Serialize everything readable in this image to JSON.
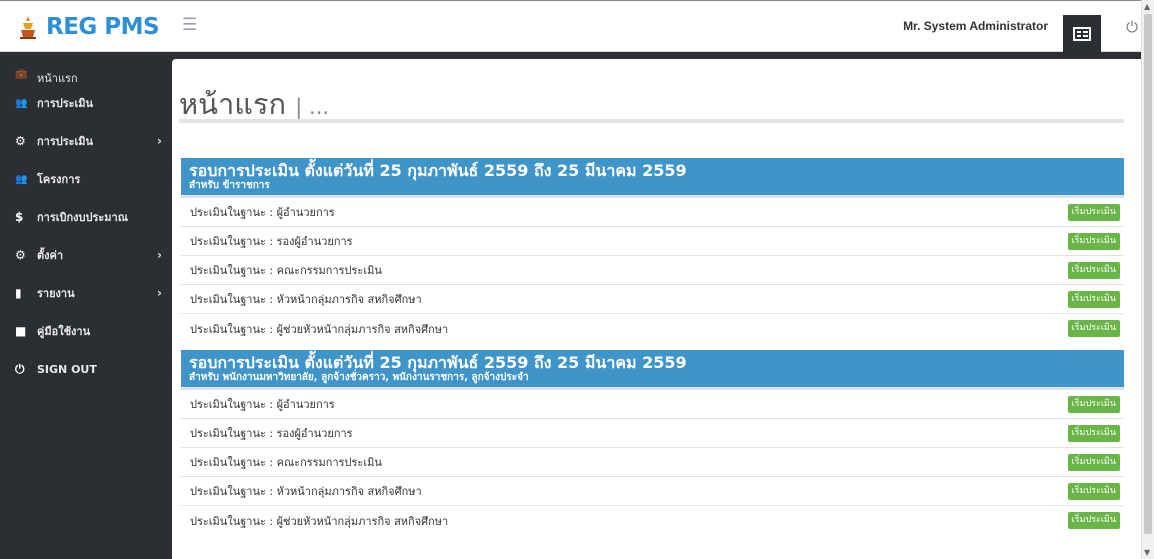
{
  "brand": {
    "name": "REG PMS"
  },
  "topbar": {
    "user_name": "Mr. System Administrator"
  },
  "sidebar": {
    "items": [
      {
        "label": "หน้าแรก",
        "icon": "briefcase-icon",
        "has_submenu": false
      },
      {
        "label": "การประเมิน",
        "icon": "users-icon",
        "has_submenu": false
      },
      {
        "label": "การประเมิน",
        "icon": "gears-icon",
        "has_submenu": true
      },
      {
        "label": "โครงการ",
        "icon": "users-icon",
        "has_submenu": false
      },
      {
        "label": "การเบิกงบประมาณ",
        "icon": "dollar-icon",
        "has_submenu": false
      },
      {
        "label": "ตั้งค่า",
        "icon": "gears-icon",
        "has_submenu": true
      },
      {
        "label": "รายงาน",
        "icon": "bar-chart-icon",
        "has_submenu": true
      },
      {
        "label": "คู่มือใช้งาน",
        "icon": "book-icon",
        "has_submenu": false
      },
      {
        "label": "SIGN OUT",
        "icon": "power-icon",
        "has_submenu": false
      }
    ],
    "chevron": "›"
  },
  "main": {
    "title": "หน้าแรก",
    "title_suffix": "| ...",
    "sections": [
      {
        "title": "รอบการประเมิน ตั้งแต่วันที่ 25 กุมภาพันธ์ 2559 ถึง 25 มีนาคม 2559",
        "subtitle": "สำหรับ ข้าราชการ",
        "rows": [
          {
            "label": "ประเมินในฐานะ : ผู้อำนวยการ",
            "button": "เริ่มประเมิน"
          },
          {
            "label": "ประเมินในฐานะ : รองผู้อำนวยการ",
            "button": "เริ่มประเมิน"
          },
          {
            "label": "ประเมินในฐานะ : คณะกรรมการประเมิน",
            "button": "เริ่มประเมิน"
          },
          {
            "label": "ประเมินในฐานะ : หัวหน้ากลุ่มภารกิจ สหกิจศึกษา",
            "button": "เริ่มประเมิน"
          },
          {
            "label": "ประเมินในฐานะ : ผู้ช่วยหัวหน้ากลุ่มภารกิจ สหกิจศึกษา",
            "button": "เริ่มประเมิน"
          }
        ]
      },
      {
        "title": "รอบการประเมิน ตั้งแต่วันที่ 25 กุมภาพันธ์ 2559 ถึง 25 มีนาคม 2559",
        "subtitle": "สำหรับ พนักงานมหาวิทยาลัย, ลูกจ้างชั่วคราว, พนักงานราชการ, ลูกจ้างประจำ",
        "rows": [
          {
            "label": "ประเมินในฐานะ : ผู้อำนวยการ",
            "button": "เริ่มประเมิน"
          },
          {
            "label": "ประเมินในฐานะ : รองผู้อำนวยการ",
            "button": "เริ่มประเมิน"
          },
          {
            "label": "ประเมินในฐานะ : คณะกรรมการประเมิน",
            "button": "เริ่มประเมิน"
          },
          {
            "label": "ประเมินในฐานะ : หัวหน้ากลุ่มภารกิจ สหกิจศึกษา",
            "button": "เริ่มประเมิน"
          },
          {
            "label": "ประเมินในฐานะ : ผู้ช่วยหัวหน้ากลุ่มภารกิจ สหกิจศึกษา",
            "button": "เริ่มประเมิน"
          }
        ]
      }
    ]
  },
  "colors": {
    "brand": "#2f8fd6",
    "sidebar_bg": "#2b2e33",
    "section_header": "#3f94c9",
    "start_button": "#69b547"
  }
}
